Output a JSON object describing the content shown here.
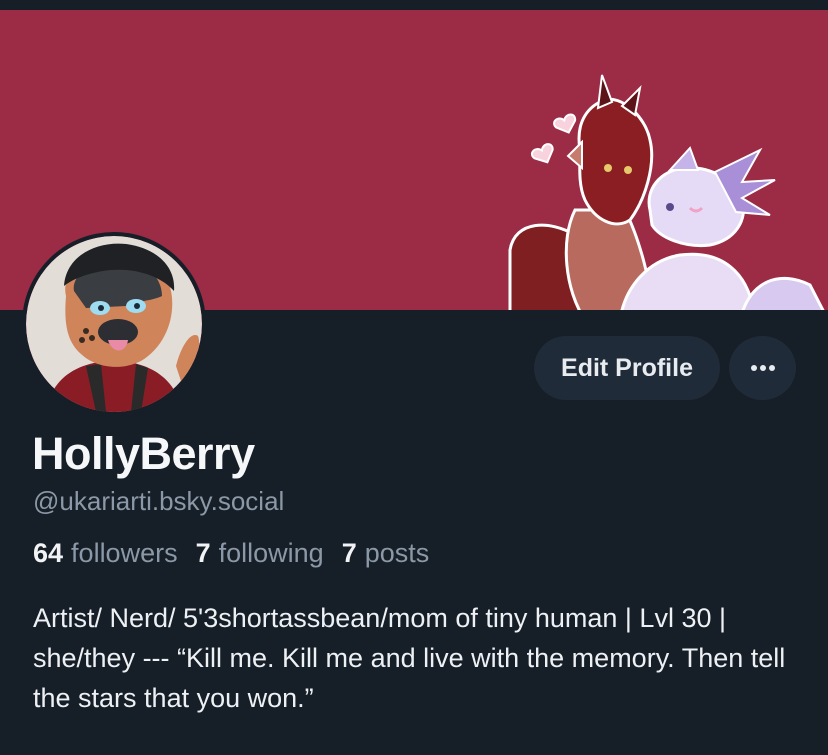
{
  "profile": {
    "display_name": "HollyBerry",
    "handle": "@ukariarti.bsky.social",
    "bio": "Artist/ Nerd/ 5'3shortassbean/mom of tiny human | Lvl 30 | she/they --- “Kill me. Kill me and live with the memory. Then tell the stars that you won.”"
  },
  "stats": {
    "followers_count": "64",
    "followers_label": "followers",
    "following_count": "7",
    "following_label": "following",
    "posts_count": "7",
    "posts_label": "posts"
  },
  "actions": {
    "edit_profile_label": "Edit Profile",
    "more_icon": "ellipsis-icon"
  },
  "colors": {
    "banner": "#9c2b46",
    "background": "#161e27",
    "button": "#1f2b38",
    "muted_text": "#8b98a7"
  }
}
